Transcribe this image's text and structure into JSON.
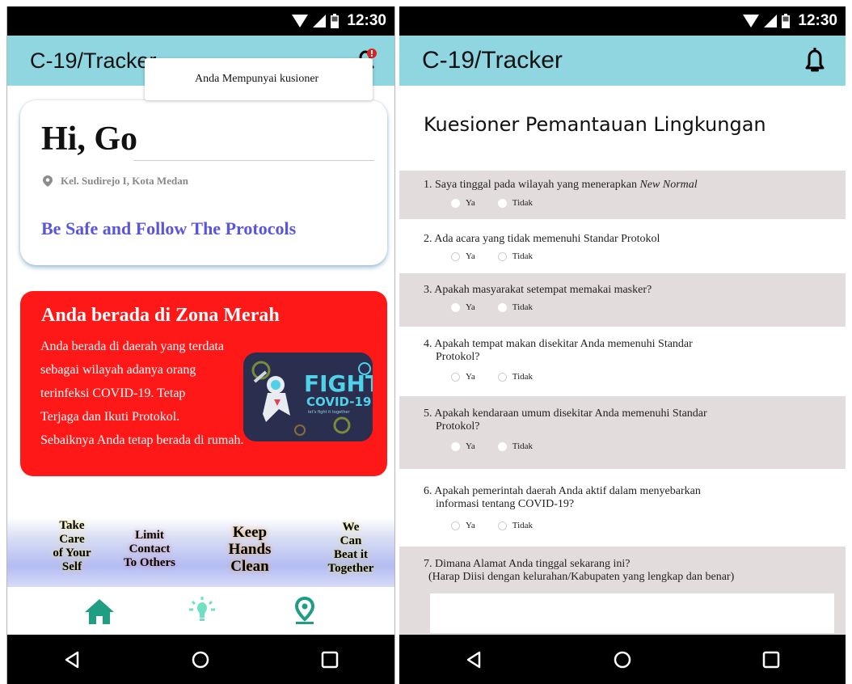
{
  "status": {
    "time": "12:30"
  },
  "left": {
    "app_title": "C-19/Tracker",
    "tooltip": "Anda Mempunyai kusioner",
    "greeting": "Hi, Go",
    "location": "Kel. Sudirejo I, Kota Medan",
    "tagline": "Be Safe and Follow The Protocols",
    "zone": {
      "title": "Anda berada di Zona Merah",
      "lines": [
        "Anda berada di daerah yang terdata",
        "sebagai wilayah adanya orang",
        "terinfeksi COVID-19. Tetap",
        "Terjaga dan Ikuti Protokol.",
        "Sebaiknya Anda tetap berada di rumah."
      ],
      "image": {
        "title": "FIGHT",
        "subtitle": "COVID-19",
        "caption": "let's fight it together",
        "color_accent": "#4fd1e8"
      }
    },
    "tips": [
      [
        "Take",
        "Care",
        "of Your",
        "Self"
      ],
      [
        "Limit",
        "Contact",
        "To Others"
      ],
      [
        "Keep",
        "Hands",
        "Clean"
      ],
      [
        "We",
        "Can",
        "Beat it",
        "Together"
      ]
    ],
    "tabs": [
      "home-icon",
      "lightbulb-icon",
      "map-pin-icon"
    ],
    "accent_color": "#1f9e84",
    "zone_color": "#ff1818"
  },
  "right": {
    "app_title": "C-19/Tracker",
    "form_title": "Kuesioner Pemantauan Lingkungan",
    "option_yes": "Ya",
    "option_no": "Tidak",
    "questions": [
      {
        "prefix": "1. Saya tinggal pada wilayah yang menerapkan ",
        "emphasis": "New Normal"
      },
      {
        "text": "2. Ada acara yang tidak memenuhi Standar Protokol"
      },
      {
        "text": "3. Apakah masyarakat setempat memakai masker?"
      },
      {
        "line1": "4. Apakah tempat makan disekitar Anda memenuhi Standar",
        "line2": "Protokol?"
      },
      {
        "line1": "5. Apakah kendaraan umum disekitar Anda memenuhi Standar",
        "line2": "Protokol?"
      },
      {
        "line1": "6. Apakah pemerintah daerah Anda aktif dalam menyebarkan",
        "line2": "informasi tentang COVID-19?"
      },
      {
        "line1": "7. Dimana Alamat Anda tinggal sekarang ini?",
        "line2": "(Harap Diisi dengan kelurahan/Kabupaten yang lengkap dan benar)",
        "input_value": ""
      }
    ],
    "shade_color": "#e2dcdc",
    "header_color": "#8fd6e1"
  }
}
